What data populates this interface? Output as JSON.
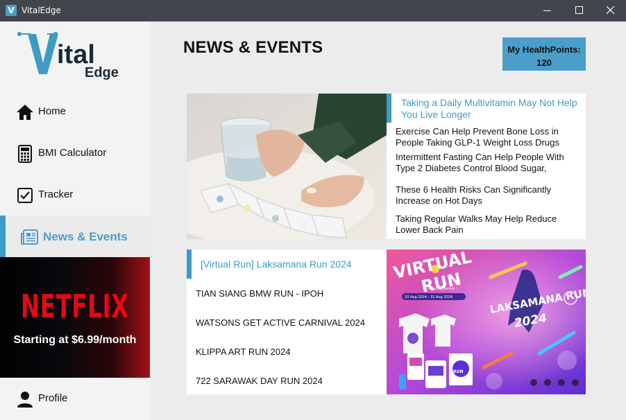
{
  "window": {
    "title": "VitalEdge",
    "icon_letter": "V"
  },
  "logo": {
    "text_main": "ital",
    "text_sub": "Edge"
  },
  "sidebar": {
    "items": [
      {
        "label": "Home",
        "icon": "home-icon"
      },
      {
        "label": "BMI Calculator",
        "icon": "calculator-icon"
      },
      {
        "label": "Tracker",
        "icon": "checkbox-icon"
      },
      {
        "label": "News & Events",
        "icon": "newspaper-icon",
        "active": true
      }
    ],
    "profile_label": "Profile"
  },
  "ad": {
    "brand": "NETFLIX",
    "text": "Starting at $6.99/month"
  },
  "main": {
    "title": "NEWS & EVENTS",
    "healthpoints_label": "My HealthPoints:",
    "healthpoints_value": "120"
  },
  "news": {
    "featured": "Taking a Daily Multivitamin May Not Help You Live Longer",
    "items": [
      "Exercise Can Help Prevent Bone Loss in People Taking GLP-1 Weight Loss Drugs",
      "Intermittent Fasting Can Help People With Type 2 Diabetes Control Blood Sugar,",
      "These 6 Health Risks Can Significantly Increase on Hot Days",
      "Taking Regular Walks May Help Reduce Lower Back Pain"
    ]
  },
  "events": {
    "featured": "[Virtual Run] Laksamana Run 2024",
    "items": [
      "TIAN SIANG BMW RUN - IPOH",
      "WATSONS GET ACTIVE CARNIVAL 2024",
      "KLIPPA ART RUN 2024",
      "722 SARAWAK DAY RUN 2024"
    ],
    "poster": {
      "headline": "VIRTUAL RUN",
      "event_name": "LAKSAMANA RUN",
      "year": "2024",
      "period_label": "Running period :",
      "period": "10 Aug 2024 - 31 Aug 2024"
    }
  },
  "colors": {
    "accent": "#3d9bc4",
    "titlebar": "#41464c",
    "ad_red": "#e50914"
  }
}
